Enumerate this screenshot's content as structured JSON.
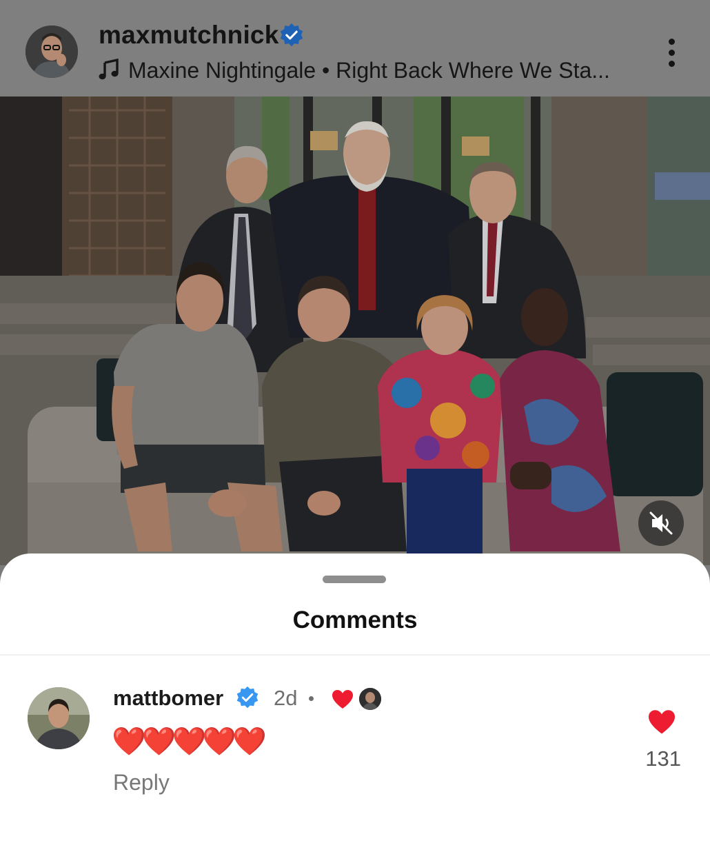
{
  "post": {
    "username": "maxmutchnick",
    "verified": true,
    "music_text": "Maxine Nightingale • Right Back Where We Sta...",
    "icons": {
      "music": "music-note-icon",
      "more": "more-options-icon",
      "verified": "verified-badge-icon",
      "mute": "muted-speaker-icon"
    }
  },
  "comments_sheet": {
    "title": "Comments",
    "comments": [
      {
        "username": "mattbomer",
        "verified": true,
        "time": "2d",
        "text": "❤️❤️❤️❤️❤️",
        "reply_label": "Reply",
        "like_count": "131",
        "liked_by_author": true
      }
    ]
  },
  "colors": {
    "verified": "#3897f0",
    "heart": "#ed1c30",
    "header_bg": "#7f7f7f",
    "sheet_bg": "#ffffff"
  }
}
